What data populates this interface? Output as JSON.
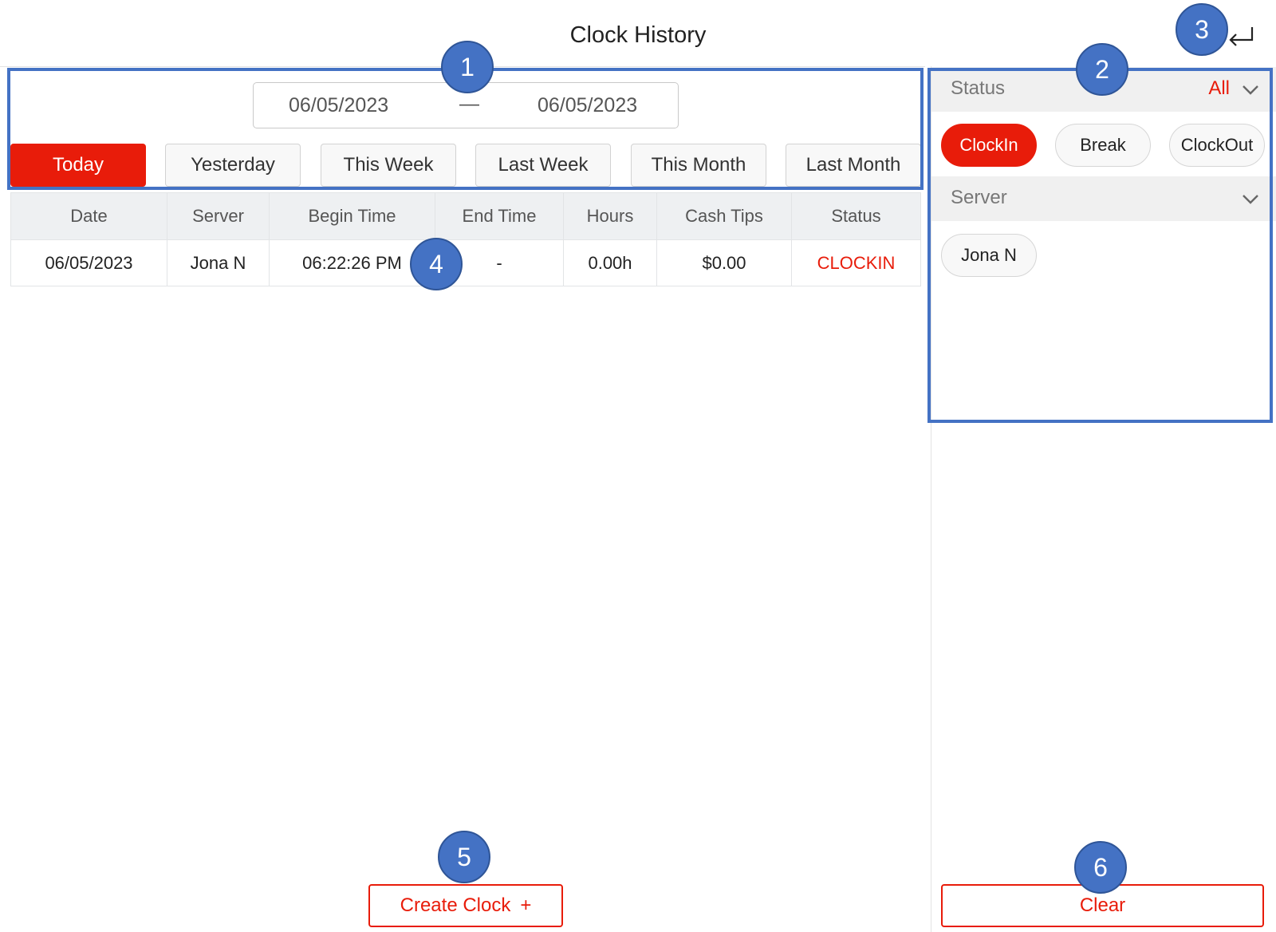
{
  "header": {
    "title": "Clock History"
  },
  "date_range": {
    "start": "06/05/2023",
    "separator": "—",
    "end": "06/05/2023"
  },
  "quick_filters": [
    {
      "label": "Today",
      "active": true
    },
    {
      "label": "Yesterday",
      "active": false
    },
    {
      "label": "This Week",
      "active": false
    },
    {
      "label": "Last Week",
      "active": false
    },
    {
      "label": "This Month",
      "active": false
    },
    {
      "label": "Last Month",
      "active": false
    }
  ],
  "table": {
    "columns": [
      "Date",
      "Server",
      "Begin Time",
      "End Time",
      "Hours",
      "Cash Tips",
      "Status"
    ],
    "rows": [
      {
        "date": "06/05/2023",
        "server": "Jona N",
        "begin_time": "06:22:26 PM",
        "end_time": "-",
        "hours": "0.00h",
        "cash_tips": "$0.00",
        "status": "CLOCKIN"
      }
    ]
  },
  "actions": {
    "create_clock": "Create Clock",
    "create_icon": "+",
    "clear": "Clear"
  },
  "filter_panel": {
    "status": {
      "label": "Status",
      "value": "All",
      "options": [
        {
          "label": "ClockIn",
          "active": true
        },
        {
          "label": "Break",
          "active": false
        },
        {
          "label": "ClockOut",
          "active": false
        }
      ]
    },
    "server": {
      "label": "Server",
      "options": [
        {
          "label": "Jona N",
          "active": false
        }
      ]
    }
  },
  "annotations": {
    "markers": [
      "1",
      "2",
      "3",
      "4",
      "5",
      "6"
    ]
  },
  "colors": {
    "accent": "#e81c0a",
    "annotation": "#4472c4",
    "header_bg": "#eef0f2"
  },
  "icons": {
    "back": "return-arrow-icon",
    "expand": "chevron-down-icon"
  }
}
